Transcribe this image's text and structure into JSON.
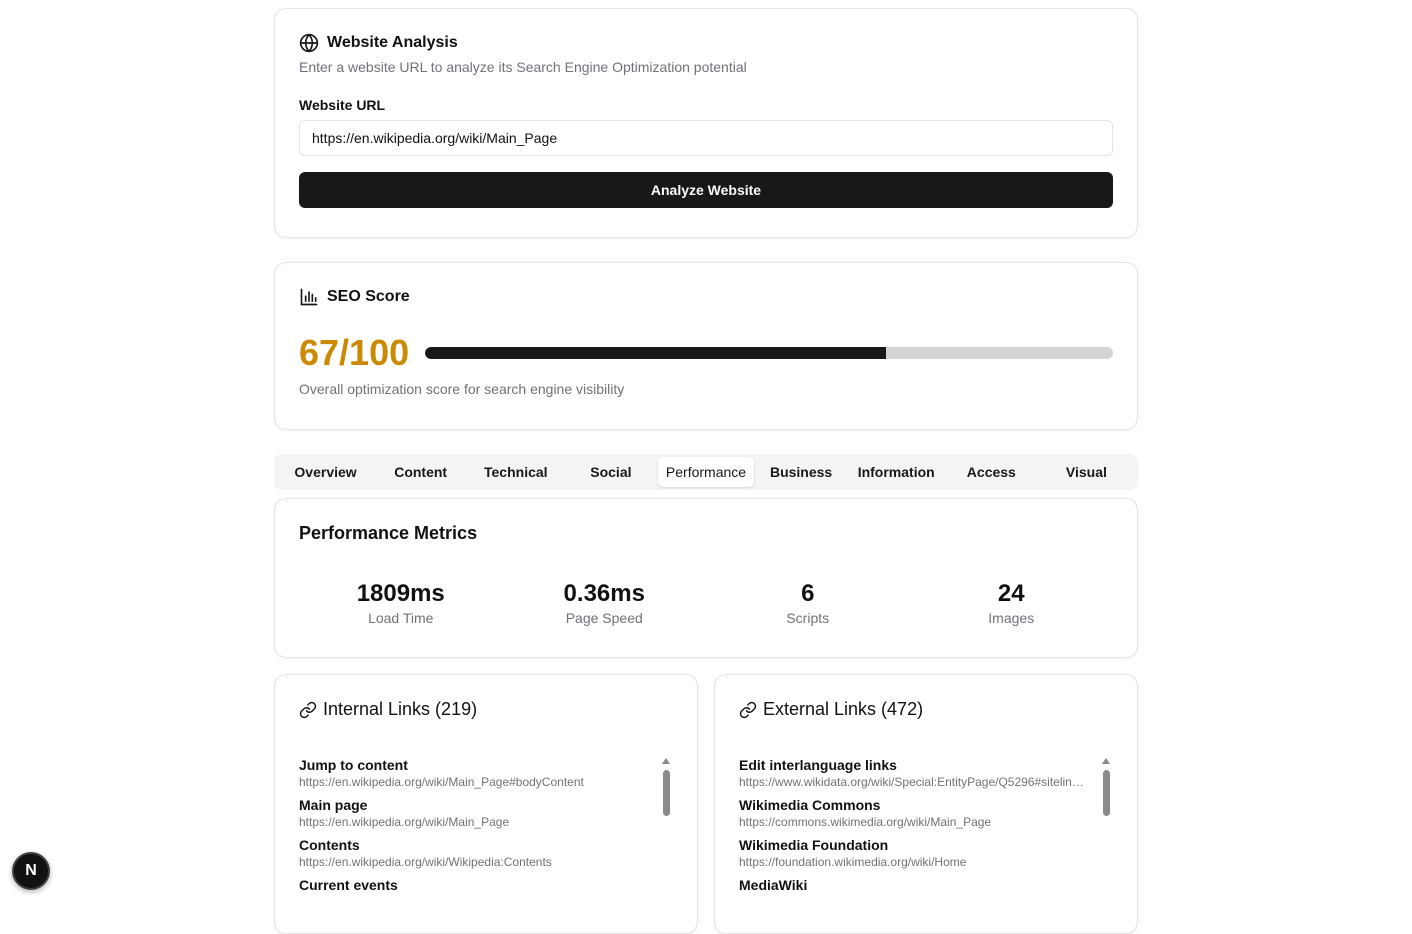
{
  "analysis": {
    "title": "Website Analysis",
    "subtitle": "Enter a website URL to analyze its Search Engine Optimization potential",
    "url_label": "Website URL",
    "url_value": "https://en.wikipedia.org/wiki/Main_Page",
    "button_label": "Analyze Website"
  },
  "score": {
    "title": "SEO Score",
    "value_text": "67/100",
    "value": 67,
    "max": 100,
    "caption": "Overall optimization score for search engine visibility",
    "color": "#ca8a04"
  },
  "tabs": [
    {
      "label": "Overview",
      "active": false
    },
    {
      "label": "Content",
      "active": false
    },
    {
      "label": "Technical",
      "active": false
    },
    {
      "label": "Social",
      "active": false
    },
    {
      "label": "Performance",
      "active": true
    },
    {
      "label": "Business",
      "active": false
    },
    {
      "label": "Information",
      "active": false
    },
    {
      "label": "Access",
      "active": false
    },
    {
      "label": "Visual",
      "active": false
    }
  ],
  "performance": {
    "title": "Performance Metrics",
    "metrics": [
      {
        "value": "1809ms",
        "label": "Load Time"
      },
      {
        "value": "0.36ms",
        "label": "Page Speed"
      },
      {
        "value": "6",
        "label": "Scripts"
      },
      {
        "value": "24",
        "label": "Images"
      }
    ]
  },
  "internal_links": {
    "title": "Internal Links (219)",
    "items": [
      {
        "text": "Jump to content",
        "url": "https://en.wikipedia.org/wiki/Main_Page#bodyContent"
      },
      {
        "text": "Main page",
        "url": "https://en.wikipedia.org/wiki/Main_Page"
      },
      {
        "text": "Contents",
        "url": "https://en.wikipedia.org/wiki/Wikipedia:Contents"
      },
      {
        "text": "Current events",
        "url": ""
      }
    ]
  },
  "external_links": {
    "title": "External Links (472)",
    "items": [
      {
        "text": "Edit interlanguage links",
        "url": "https://www.wikidata.org/wiki/Special:EntityPage/Q5296#sitelinks..."
      },
      {
        "text": "Wikimedia Commons",
        "url": "https://commons.wikimedia.org/wiki/Main_Page"
      },
      {
        "text": "Wikimedia Foundation",
        "url": "https://foundation.wikimedia.org/wiki/Home"
      },
      {
        "text": "MediaWiki",
        "url": ""
      }
    ]
  },
  "badge": {
    "letter": "N"
  },
  "icons": {
    "analysis": "globe-icon",
    "score": "bar-chart-icon",
    "links": "link-icon"
  }
}
